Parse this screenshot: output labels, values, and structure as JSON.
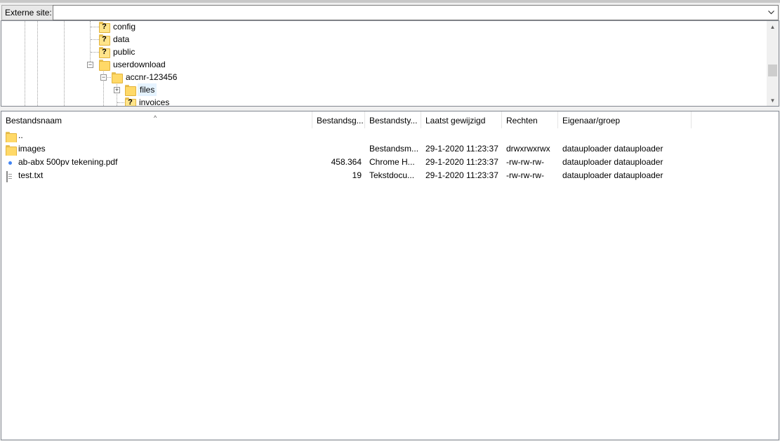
{
  "address_bar": {
    "label": "Externe site:",
    "value": ""
  },
  "tree": {
    "nodes": [
      {
        "label": "config",
        "icon": "unknown-folder-icon"
      },
      {
        "label": "data",
        "icon": "unknown-folder-icon"
      },
      {
        "label": "public",
        "icon": "unknown-folder-icon"
      },
      {
        "label": "userdownload",
        "icon": "folder-icon"
      },
      {
        "label": "accnr-123456",
        "icon": "folder-icon"
      },
      {
        "label": "files",
        "icon": "folder-icon"
      },
      {
        "label": "invoices",
        "icon": "unknown-folder-icon"
      }
    ]
  },
  "file_list": {
    "columns": [
      "Bestandsnaam",
      "Bestandsg...",
      "Bestandsty...",
      "Laatst gewijzigd",
      "Rechten",
      "Eigenaar/groep"
    ],
    "rows": [
      {
        "name": "..",
        "size": "",
        "type": "",
        "modified": "",
        "permissions": "",
        "owner": "",
        "icon": "folder-icon"
      },
      {
        "name": "images",
        "size": "",
        "type": "Bestandsm...",
        "modified": "29-1-2020 11:23:37",
        "permissions": "drwxrwxrwx",
        "owner": "datauploader datauploader",
        "icon": "folder-icon"
      },
      {
        "name": "ab-abx 500pv tekening.pdf",
        "size": "458.364",
        "type": "Chrome H...",
        "modified": "29-1-2020 11:23:37",
        "permissions": "-rw-rw-rw-",
        "owner": "datauploader datauploader",
        "icon": "chrome-icon"
      },
      {
        "name": "test.txt",
        "size": "19",
        "type": "Tekstdocu...",
        "modified": "29-1-2020 11:23:37",
        "permissions": "-rw-rw-rw-",
        "owner": "datauploader datauploader",
        "icon": "text-file-icon"
      }
    ]
  }
}
